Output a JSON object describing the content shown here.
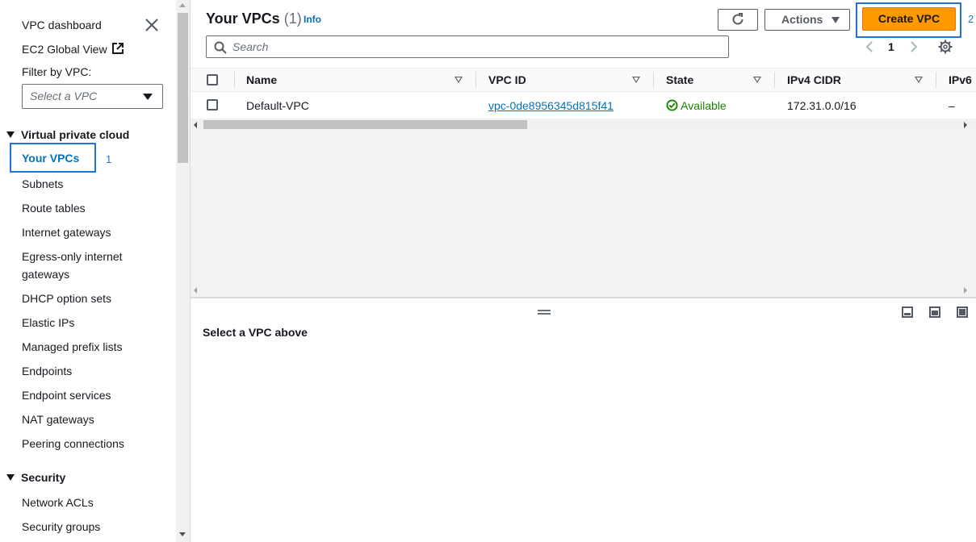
{
  "sidebar": {
    "vpc_dashboard": "VPC dashboard",
    "ec2_global_view": "EC2 Global View",
    "filter_label": "Filter by VPC:",
    "filter_placeholder": "Select a VPC",
    "section_vpc": "Virtual private cloud",
    "items": [
      "Your VPCs",
      "Subnets",
      "Route tables",
      "Internet gateways",
      "Egress-only internet",
      "gateways",
      "DHCP option sets",
      "Elastic IPs",
      "Managed prefix lists",
      "Endpoints",
      "Endpoint services",
      "NAT gateways",
      "Peering connections"
    ],
    "section_security": "Security",
    "security_items": [
      "Network ACLs",
      "Security groups"
    ],
    "step_marker_1": "1"
  },
  "header": {
    "title": "Your VPCs",
    "count": "(1)",
    "info": "Info",
    "actions_label": "Actions",
    "create_label": "Create VPC",
    "step_marker_2": "2"
  },
  "search": {
    "placeholder": "Search"
  },
  "pagination": {
    "page": "1"
  },
  "table": {
    "columns": [
      "Name",
      "VPC ID",
      "State",
      "IPv4 CIDR",
      "IPv6"
    ],
    "rows": [
      {
        "name": "Default-VPC",
        "vpc_id": "vpc-0de8956345d815f41",
        "state": "Available",
        "ipv4_cidr": "172.31.0.0/16",
        "ipv6": "–"
      }
    ]
  },
  "detail": {
    "empty_message": "Select a VPC above"
  },
  "colors": {
    "accent": "#ff9900",
    "link": "#0073bb",
    "highlight": "#1f73d8",
    "success": "#1d8102"
  }
}
